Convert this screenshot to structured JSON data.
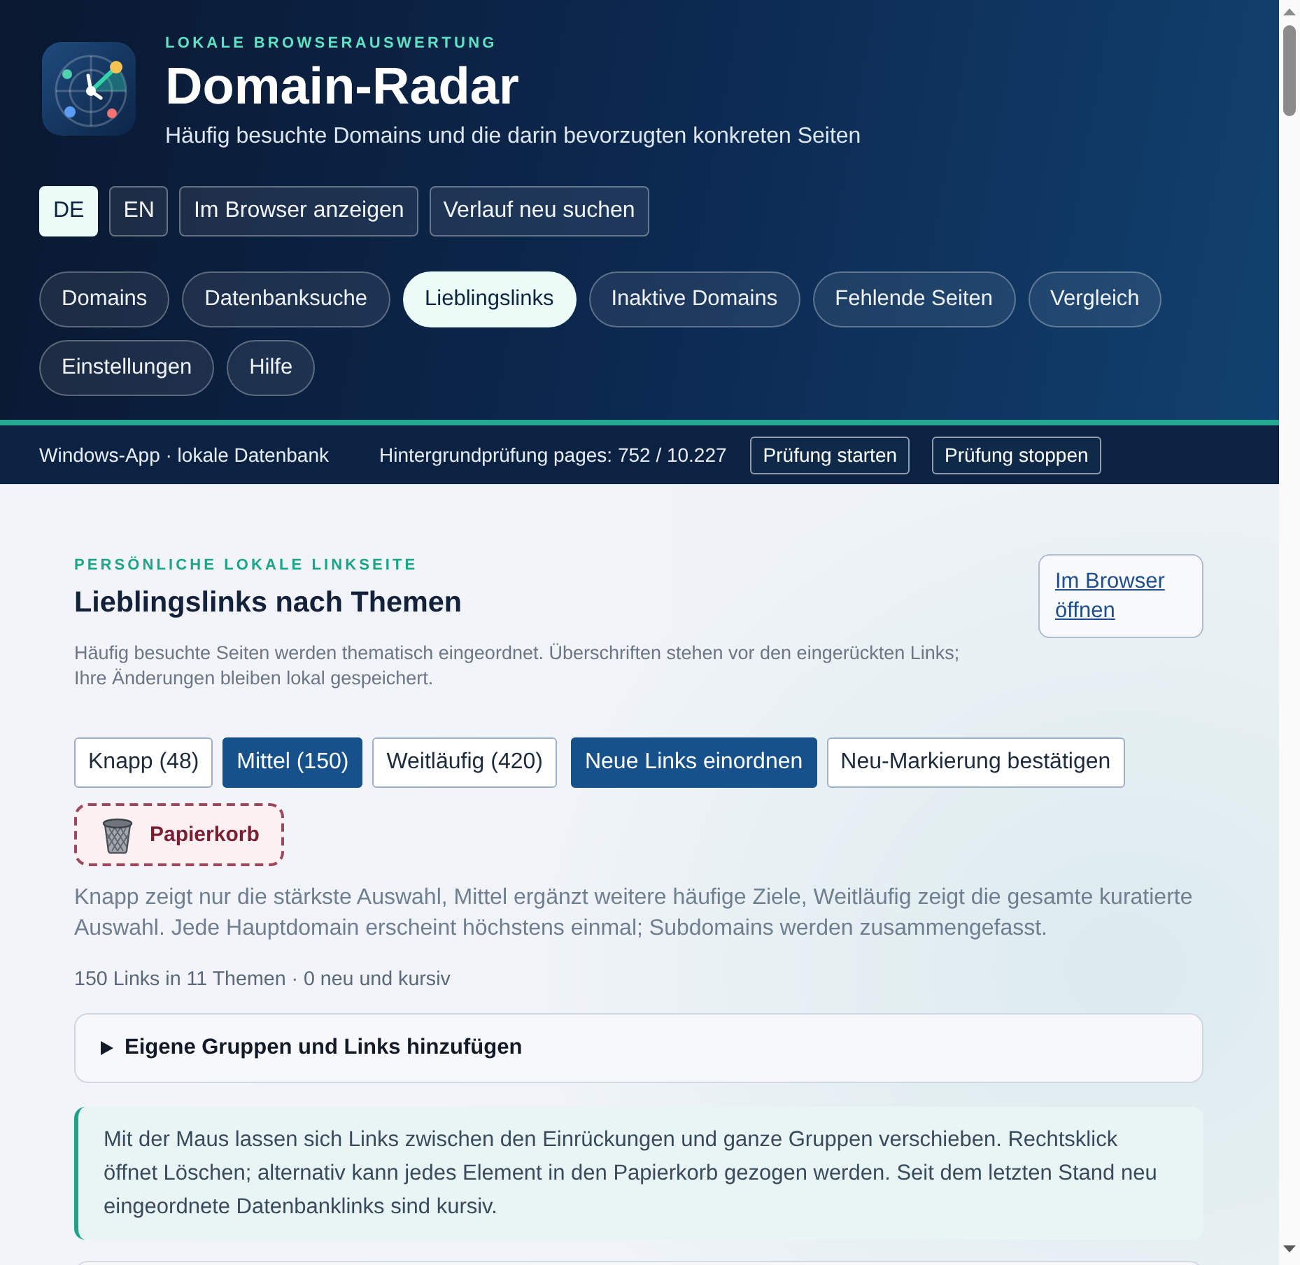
{
  "header": {
    "eyebrow": "LOKALE BROWSERAUSWERTUNG",
    "title": "Domain-Radar",
    "subtitle": "Häufig besuchte Domains und die darin bevorzugten konkreten Seiten"
  },
  "languages": [
    {
      "label": "DE",
      "selected": true
    },
    {
      "label": "EN",
      "selected": false
    }
  ],
  "actions": [
    "Im Browser anzeigen",
    "Verlauf neu suchen"
  ],
  "tabs": [
    {
      "label": "Domains",
      "selected": false
    },
    {
      "label": "Datenbanksuche",
      "selected": false
    },
    {
      "label": "Lieblingslinks",
      "selected": true
    },
    {
      "label": "Inaktive Domains",
      "selected": false
    },
    {
      "label": "Fehlende Seiten",
      "selected": false
    },
    {
      "label": "Vergleich",
      "selected": false
    },
    {
      "label": "Einstellungen",
      "selected": false
    },
    {
      "label": "Hilfe",
      "selected": false
    }
  ],
  "status_bar": {
    "app": "Windows-App · lokale Datenbank",
    "progress": "Hintergrundprüfung pages: 752 / 10.227",
    "buttons": [
      "Prüfung starten",
      "Prüfung stoppen"
    ]
  },
  "page": {
    "eyebrow": "PERSÖNLICHE LOKALE LINKSEITE",
    "title": "Lieblingslinks nach Themen",
    "description": "Häufig besuchte Seiten werden thematisch eingeordnet. Überschriften stehen vor den eingerückten Links; Ihre Änderungen bleiben lokal gespeichert.",
    "open_button": "Im Browser öffnen",
    "sizes": [
      {
        "label": "Knapp (48)",
        "selected": false
      },
      {
        "label": "Mittel (150)",
        "selected": true
      },
      {
        "label": "Weitläufig (420)",
        "selected": false
      }
    ],
    "actions": [
      {
        "label": "Neue Links einordnen",
        "kind": "primary"
      },
      {
        "label": "Neu-Markierung bestätigen",
        "kind": "outline"
      }
    ],
    "trash": {
      "label": "Papierkorb"
    },
    "explanation": "Knapp zeigt nur die stärkste Auswahl, Mittel ergänzt weitere häufige Ziele, Weitläufig zeigt die gesamte kuratierte Auswahl. Jede Hauptdomain erscheint höchstens einmal; Subdomains werden zusammengefasst.",
    "summary": "150 Links in 11 Themen · 0 neu und kursiv",
    "details": {
      "label": "Eigene Gruppen und Links hinzufügen",
      "expanded": false
    },
    "hint": "Mit der Maus lassen sich Links zwischen den Einrückungen und ganze Gruppen verschieben. Rechtsklick öffnet Löschen; alternativ kann jedes Element in den Papierkorb gezogen werden. Seit dem letzten Stand neu eingeordnete Datenbanklinks sind kursiv."
  }
}
